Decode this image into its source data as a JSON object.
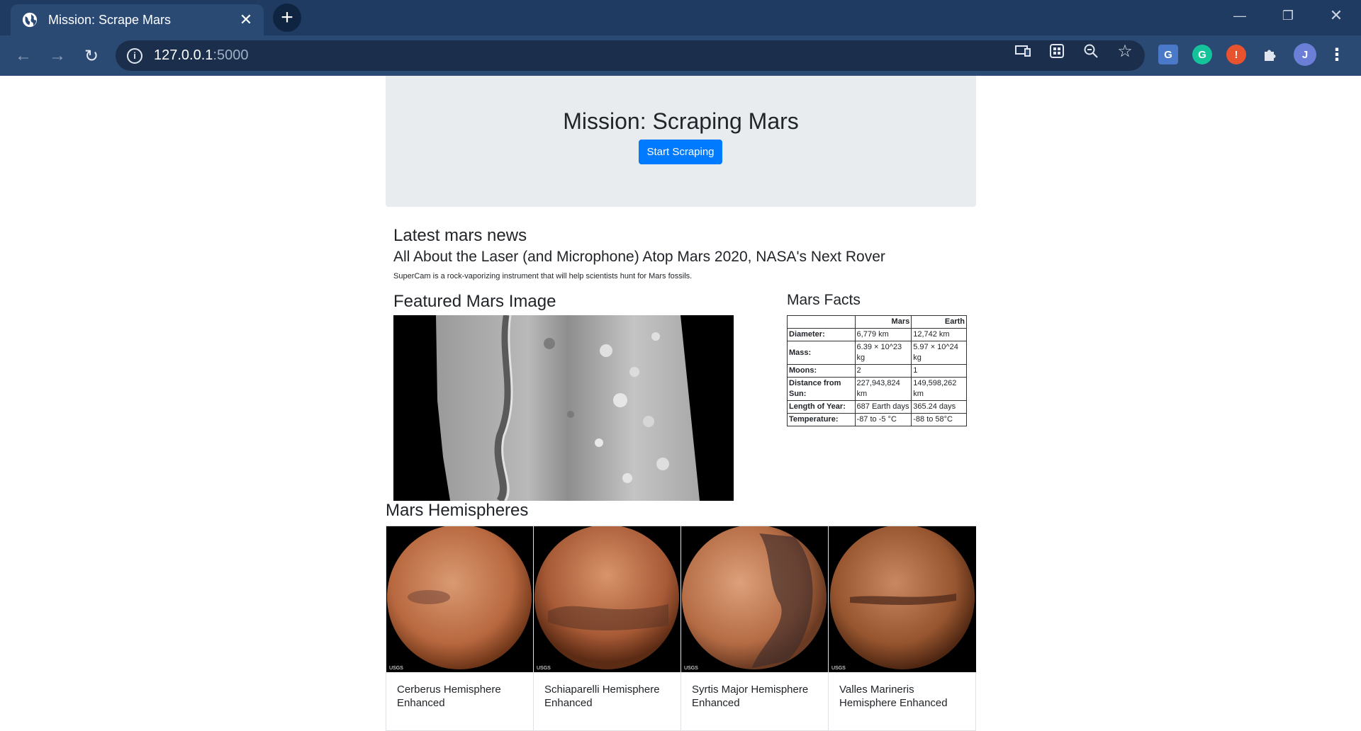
{
  "browser": {
    "tab_title": "Mission: Scrape Mars",
    "url_host": "127.0.0.1",
    "url_port": ":5000",
    "profile_initial": "J"
  },
  "page": {
    "jumbotron": {
      "title": "Mission: Scraping Mars",
      "button_label": "Start Scraping"
    },
    "news": {
      "heading": "Latest mars news",
      "title": "All About the Laser (and Microphone) Atop Mars 2020, NASA's Next Rover",
      "paragraph": "SuperCam is a rock-vaporizing instrument that will help scientists hunt for Mars fossils."
    },
    "featured": {
      "heading": "Featured Mars Image"
    },
    "facts": {
      "heading": "Mars Facts",
      "columns": [
        "",
        "Mars",
        "Earth"
      ],
      "rows": [
        {
          "label": "Diameter:",
          "mars": "6,779 km",
          "earth": "12,742 km"
        },
        {
          "label": "Mass:",
          "mars": "6.39 × 10^23 kg",
          "earth": "5.97 × 10^24 kg"
        },
        {
          "label": "Moons:",
          "mars": "2",
          "earth": "1"
        },
        {
          "label": "Distance from Sun:",
          "mars": "227,943,824 km",
          "earth": "149,598,262 km"
        },
        {
          "label": "Length of Year:",
          "mars": "687 Earth days",
          "earth": "365.24 days"
        },
        {
          "label": "Temperature:",
          "mars": "-87 to -5 °C",
          "earth": "-88 to 58°C"
        }
      ]
    },
    "hemispheres": {
      "heading": "Mars Hemispheres",
      "items": [
        {
          "caption": "Cerberus Hemisphere Enhanced",
          "badge": "USGS"
        },
        {
          "caption": "Schiaparelli Hemisphere Enhanced",
          "badge": "USGS"
        },
        {
          "caption": "Syrtis Major Hemisphere Enhanced",
          "badge": "USGS"
        },
        {
          "caption": "Valles Marineris Hemisphere Enhanced",
          "badge": "USGS"
        }
      ]
    }
  },
  "colors": {
    "chrome_dark": "#1f3b61",
    "chrome_tab": "#2a4a73",
    "primary": "#007bff",
    "jumbotron_bg": "#e9ecef"
  },
  "icons": [
    "globe-icon",
    "close-icon",
    "plus-icon",
    "back-icon",
    "forward-icon",
    "reload-icon",
    "info-icon",
    "cast-icon",
    "apps-icon",
    "zoom-icon",
    "star-icon",
    "translate-icon",
    "grammarly-icon",
    "alert-icon",
    "puzzle-icon",
    "menu-icon"
  ]
}
